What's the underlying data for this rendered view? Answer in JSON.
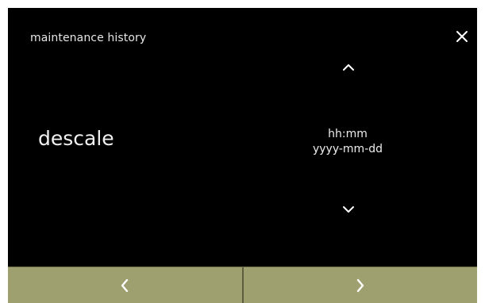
{
  "screen": {
    "title": "maintenance history",
    "close_icon": "close-icon"
  },
  "entry": {
    "label": "descale",
    "time": "hh:mm",
    "date": "yyyy-mm-dd",
    "up_icon": "chevron-up-icon",
    "down_icon": "chevron-down-icon"
  },
  "navbar": {
    "prev_icon": "chevron-left-icon",
    "next_icon": "chevron-right-icon"
  },
  "colors": {
    "background": "#000000",
    "text": "#f0f0f0",
    "navbar": "#9ea06f",
    "nav_icon": "#ffffff"
  }
}
